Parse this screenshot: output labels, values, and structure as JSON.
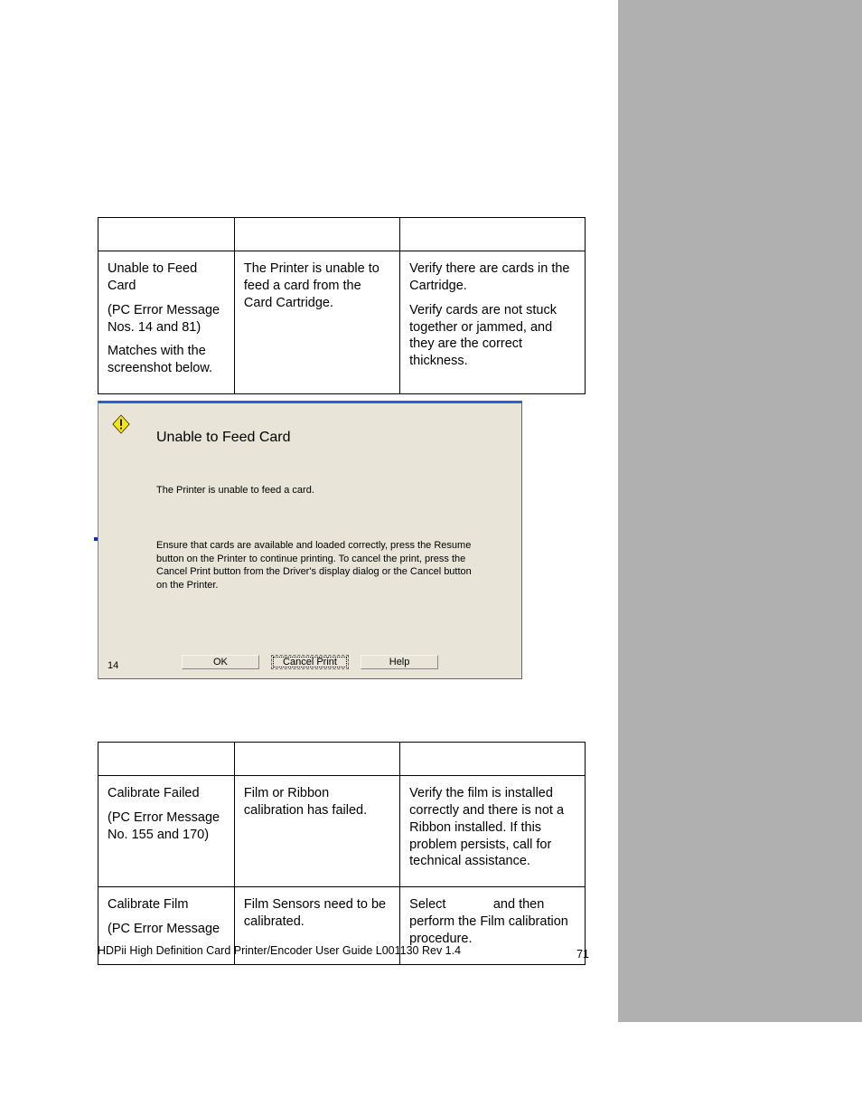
{
  "table1": {
    "row1": {
      "c1p1": "Unable to Feed Card",
      "c1p2": "(PC Error Message Nos. 14 and 81)",
      "c1p3": "Matches with the screenshot below.",
      "c2p1": "The Printer is unable to feed a card from the Card Cartridge.",
      "c3p1": "Verify there are cards in the Cartridge.",
      "c3p2": "Verify cards are not stuck together or jammed, and they are the correct thickness."
    }
  },
  "dialog": {
    "title": "Unable to Feed Card",
    "msg1": "The Printer is unable to feed a card.",
    "msg2": "Ensure that cards are available and loaded correctly, press the Resume button on the Printer to continue printing. To cancel the print, press the Cancel Print button from the Driver's display dialog or the Cancel button on the Printer.",
    "code": "14",
    "btn_ok": "OK",
    "btn_cancel": "Cancel Print",
    "btn_help": "Help"
  },
  "table2": {
    "row1": {
      "c1p1": "Calibrate Failed",
      "c1p2": "(PC Error Message No. 155 and 170)",
      "c2p1": "Film or Ribbon calibration has failed.",
      "c3p1": "Verify the film is installed correctly and there is not a Ribbon installed. If this problem persists, call for technical assistance."
    },
    "row2": {
      "c1p1": "Calibrate Film",
      "c1p2": "(PC Error Message",
      "c2p1": "Film Sensors need to be calibrated.",
      "c3a": "Select ",
      "c3b": " and then perform the Film calibration procedure."
    }
  },
  "footer": {
    "text": "HDPii High Definition Card Printer/Encoder User Guide    L001130 Rev 1.4",
    "page": "71"
  }
}
